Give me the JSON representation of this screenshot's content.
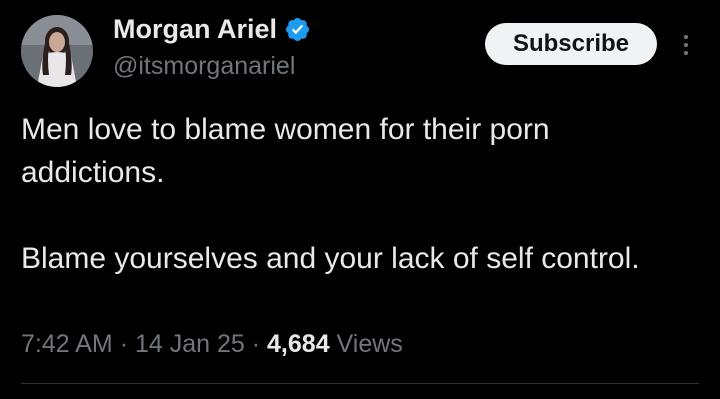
{
  "author": {
    "display_name": "Morgan Ariel",
    "handle": "@itsmorganariel",
    "verified_color": "#1d9bf0"
  },
  "actions": {
    "subscribe_label": "Subscribe",
    "more_icon": "more-vertical-icon"
  },
  "tweet": {
    "paragraphs": [
      "Men love to blame women for their porn addictions.",
      "Blame yourselves and your lack of self control."
    ]
  },
  "meta": {
    "time": "7:42 AM",
    "separator": "·",
    "date": "14 Jan 25",
    "views_count": "4,684",
    "views_label": "Views"
  },
  "colors": {
    "background": "#000000",
    "text_primary": "#e7e9ea",
    "text_secondary": "#71767b",
    "button_bg": "#eff3f4",
    "divider": "#2f3336"
  }
}
